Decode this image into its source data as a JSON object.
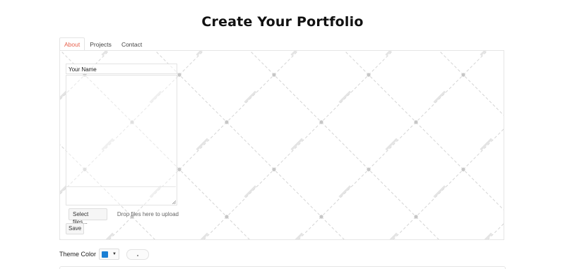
{
  "page": {
    "title": "Create Your Portfolio"
  },
  "tabs": [
    {
      "label": "About",
      "active": true
    },
    {
      "label": "Projects",
      "active": false
    },
    {
      "label": "Contact",
      "active": false
    }
  ],
  "about_form": {
    "name_value": "Your Name",
    "bio_value": "",
    "select_files_label": "Select files...",
    "drop_text": "Drop files here to upload",
    "save_label": "Save"
  },
  "theme": {
    "label": "Theme Color",
    "color": "#1a7fd4",
    "toggle_on": false
  },
  "colors": {
    "active_tab": "#e8604c",
    "border": "#e6e6e6",
    "watermark": "#cfcfcf"
  }
}
